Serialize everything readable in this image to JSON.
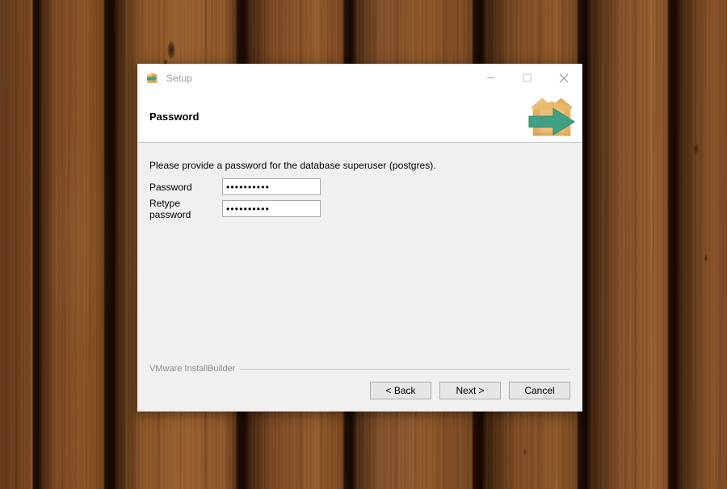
{
  "window": {
    "title": "Setup",
    "icon": "installer-box-icon",
    "controls": [
      {
        "name": "minimize",
        "glyph": "minimize-icon"
      },
      {
        "name": "maximize",
        "glyph": "maximize-icon"
      },
      {
        "name": "close",
        "glyph": "close-icon"
      }
    ]
  },
  "header": {
    "title": "Password",
    "logo": "installer-box-arrow-logo"
  },
  "main": {
    "intro": "Please provide a password for the database superuser (postgres).",
    "fields": [
      {
        "label": "Password",
        "value": "••••••••••",
        "placeholder": ""
      },
      {
        "label": "Retype password",
        "value": "••••••••••",
        "placeholder": ""
      }
    ]
  },
  "footer": {
    "brand": "VMware InstallBuilder",
    "buttons": [
      {
        "label": "< Back",
        "name": "back"
      },
      {
        "label": "Next >",
        "name": "next"
      },
      {
        "label": "Cancel",
        "name": "cancel"
      }
    ]
  },
  "colors": {
    "dialog_body": "#f0f0f0",
    "titlebar": "#ffffff",
    "box_light": "#edc07a",
    "box_mid": "#e0a858",
    "box_dark": "#cf9743",
    "arrow_green": "#41a083",
    "arrow_green_dark": "#2f8a6e",
    "button_face": "#e6e6e6",
    "brand_text": "#8d8d8d",
    "wood_background": "#7d4a21"
  }
}
